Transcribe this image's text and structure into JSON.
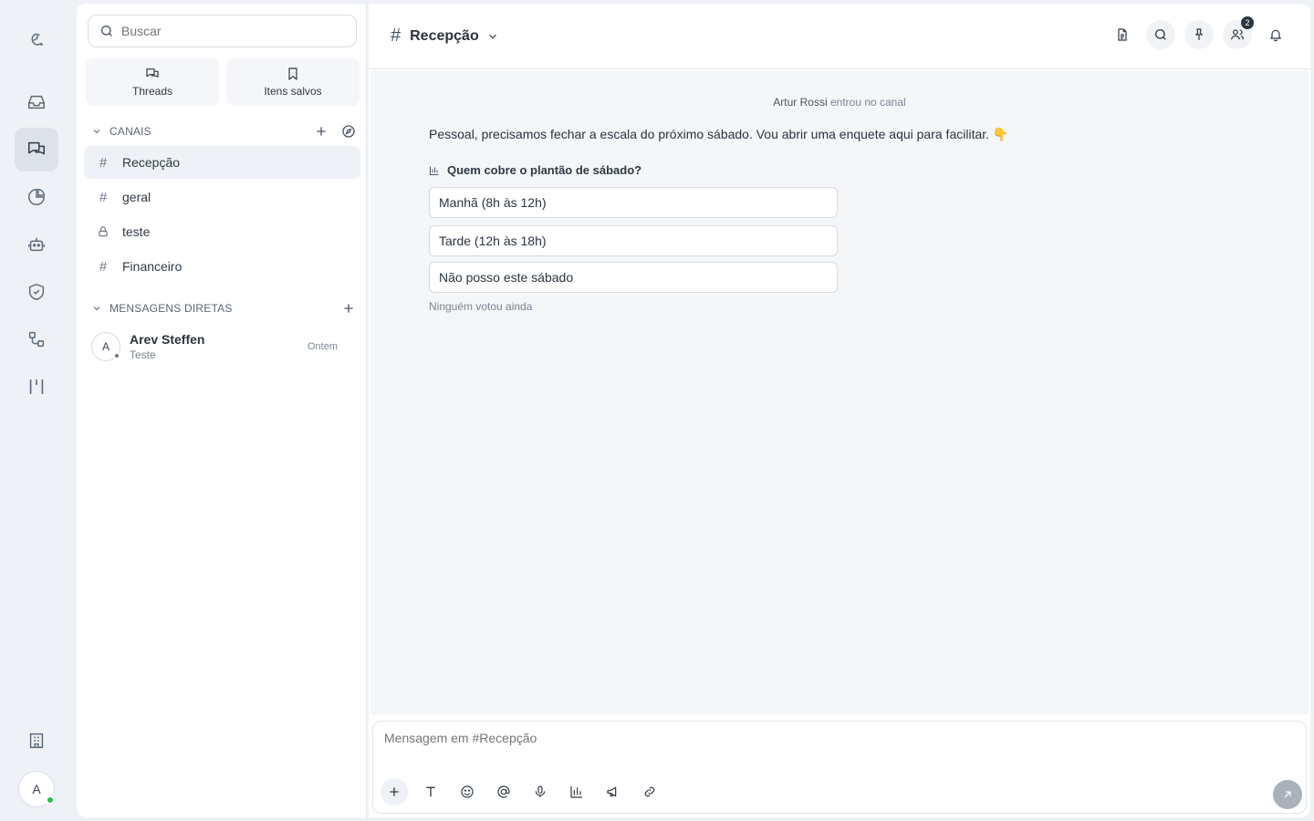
{
  "rail": {
    "avatar_letter": "A"
  },
  "sidebar": {
    "search_placeholder": "Buscar",
    "quick": [
      {
        "label": "Threads"
      },
      {
        "label": "Itens salvos"
      }
    ],
    "channels_header": "CANAIS",
    "channels": [
      {
        "name": "Recepção",
        "type": "hash"
      },
      {
        "name": "geral",
        "type": "hash"
      },
      {
        "name": "teste",
        "type": "lock"
      },
      {
        "name": "Financeiro",
        "type": "hash"
      }
    ],
    "dms_header": "MENSAGENS DIRETAS",
    "dms": [
      {
        "avatar": "A",
        "name": "Arev Steffen",
        "preview": "Teste",
        "time": "Ontem"
      }
    ]
  },
  "header": {
    "hash": "#",
    "title": "Recepção",
    "members_badge": "2"
  },
  "feed": {
    "system_user": "Artur Rossi",
    "system_text": "entrou no canal",
    "message": "Pessoal, precisamos fechar a escala do próximo sábado. Vou abrir uma enquete aqui para facilitar. 👇",
    "poll": {
      "question": "Quem cobre o plantão de sábado?",
      "options": [
        "Manhã (8h às 12h)",
        "Tarde (12h às 18h)",
        "Não posso este sábado"
      ],
      "note": "Ninguém votou ainda"
    }
  },
  "composer": {
    "placeholder": "Mensagem em #Recepção"
  }
}
